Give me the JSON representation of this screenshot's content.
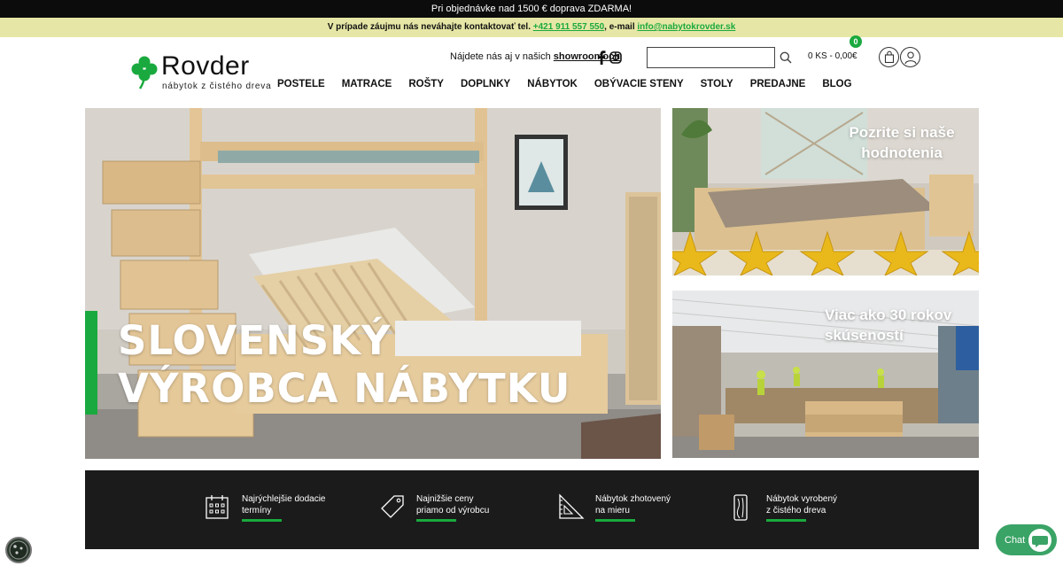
{
  "topbar": {
    "text": "Pri objednávke nad 1500 € doprava ZDARMA!"
  },
  "contactbar": {
    "prefix": "V prípade záujmu nás neváhajte kontaktovať tel.",
    "phone": "+421 911 557 550",
    "middle": ", e-mail",
    "email": "info@nabytokrovder.sk"
  },
  "logo": {
    "name": "Rovder",
    "tagline": "nábytok z čistého dreva",
    "brand_color": "#1aa93e"
  },
  "header": {
    "showroom_prefix": "Nájdete nás aj v našich",
    "showroom_link": "showroomoch",
    "social": [
      "facebook-icon",
      "instagram-icon"
    ],
    "search_placeholder": "",
    "cart_count": "0",
    "cart_summary": "0 KS - 0,00€"
  },
  "nav": {
    "items": [
      "POSTELE",
      "MATRACE",
      "ROŠTY",
      "DOPLNKY",
      "NÁBYTOK",
      "OBÝVACIE STENY",
      "STOLY",
      "PREDAJNE",
      "BLOG"
    ]
  },
  "hero": {
    "line1": "SLOVENSKÝ",
    "line2": "VÝROBCA NÁBYTKU"
  },
  "promos": {
    "reviews_line1": "Pozrite si naše",
    "reviews_line2": "hodnotenia",
    "experience_line1": "Viac ako 30 rokov",
    "experience_line2": "skúseností"
  },
  "features": [
    {
      "icon": "calendar-icon",
      "line1": "Najrýchlejšie dodacie",
      "line2": "termíny"
    },
    {
      "icon": "price-tag-icon",
      "line1": "Najnižšie ceny",
      "line2": "priamo od výrobcu"
    },
    {
      "icon": "set-square-icon",
      "line1": "Nábytok zhotovený",
      "line2": "na mieru"
    },
    {
      "icon": "wood-plank-icon",
      "line1": "Nábytok vyrobený",
      "line2": "z čistého dreva"
    }
  ],
  "widgets": {
    "chat_label": "Chat"
  }
}
